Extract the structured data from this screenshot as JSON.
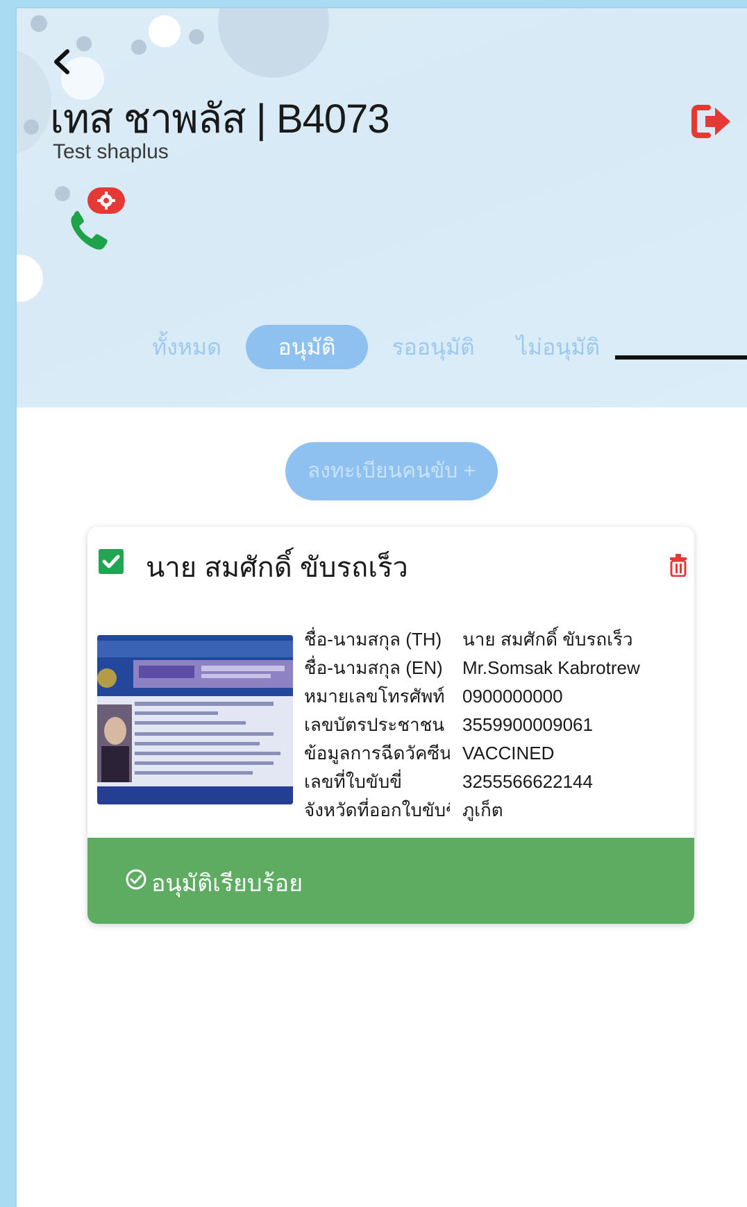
{
  "header": {
    "title": "เทส ชาพลัส | B4073",
    "subtitle": "Test shaplus"
  },
  "tabs": [
    {
      "label": "ทั้งหมด",
      "active": false
    },
    {
      "label": "อนุมัติ",
      "active": true
    },
    {
      "label": "รออนุมัติ",
      "active": false
    },
    {
      "label": "ไม่อนุมัติ",
      "active": false
    }
  ],
  "register_button": {
    "label": "ลงทะเบียนคนขับ +"
  },
  "driver_card": {
    "checked": true,
    "name": "นาย สมศักดิ์ ขับรถเร็ว",
    "fields": [
      {
        "label": "ชื่อ-นามสกุล (TH)",
        "value": "นาย สมศักดิ์ ขับรถเร็ว"
      },
      {
        "label": "ชื่อ-นามสกุล (EN)",
        "value": "Mr.Somsak Kabrotrew"
      },
      {
        "label": "หมายเลขโทรศัพท์",
        "value": "0900000000"
      },
      {
        "label": "เลขบัตรประชาชน",
        "value": "3559900009061"
      },
      {
        "label": "ข้อมูลการฉีดวัคซีน",
        "value": "VACCINED"
      },
      {
        "label": "เลขที่ใบขับขี่",
        "value": "3255566622144"
      },
      {
        "label": "จังหวัดที่ออกใบขับขี่",
        "value": "ภูเก็ต"
      }
    ],
    "status": {
      "label": "อนุมัติเรียบร้อย",
      "color": "#5eab62"
    }
  },
  "colors": {
    "accent": "#8ec1f0",
    "danger": "#e53935",
    "success": "#22a552",
    "status_bar": "#5eab62",
    "phone": "#1fa34a"
  },
  "icons": {
    "back": "chevron-left-icon",
    "logout": "logout-icon",
    "phone": "phone-icon",
    "settings_badge": "gear-icon",
    "checkbox": "checkbox-checked-icon",
    "delete": "trash-icon",
    "status": "check-circle-icon"
  }
}
